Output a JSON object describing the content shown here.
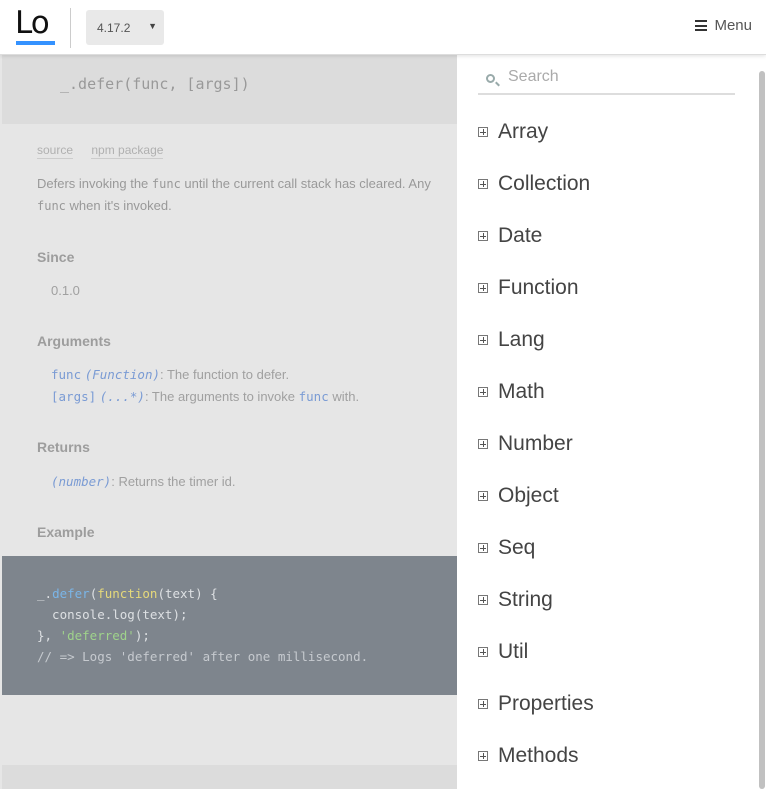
{
  "header": {
    "logo": "Lo",
    "version": "4.17.2",
    "menu_label": "Menu"
  },
  "doc": {
    "signature": "_.defer(func, [args])",
    "links": [
      "source",
      "npm package"
    ],
    "description": {
      "part1": "Defers invoking the ",
      "code1": "func",
      "part2": " until the current call stack has cleared. Any",
      "code2": "func",
      "part3": " when it's invoked."
    },
    "since_title": "Since",
    "since_value": "0.1.0",
    "arguments_title": "Arguments",
    "arguments": [
      {
        "name": "func",
        "type": "(Function)",
        "desc": ": The function to defer."
      },
      {
        "name": "[args]",
        "type": "(...*)",
        "desc_a": ": The arguments to invoke ",
        "code": "func",
        "desc_b": " with."
      }
    ],
    "returns_title": "Returns",
    "returns": {
      "type": "(number)",
      "desc": ": Returns the timer id."
    },
    "example_title": "Example",
    "code": {
      "l1_a": "_.",
      "l1_fn": "defer",
      "l1_b": "(",
      "l1_kw": "function",
      "l1_c": "(text) {",
      "l2": "  console.log(text);",
      "l3_a": "}, ",
      "l3_str": "'deferred'",
      "l3_b": ");",
      "l4": "// => Logs 'deferred' after one millisecond."
    }
  },
  "sidebar": {
    "search_placeholder": "Search",
    "items": [
      "Array",
      "Collection",
      "Date",
      "Function",
      "Lang",
      "Math",
      "Number",
      "Object",
      "Seq",
      "String",
      "Util",
      "Properties",
      "Methods"
    ]
  }
}
